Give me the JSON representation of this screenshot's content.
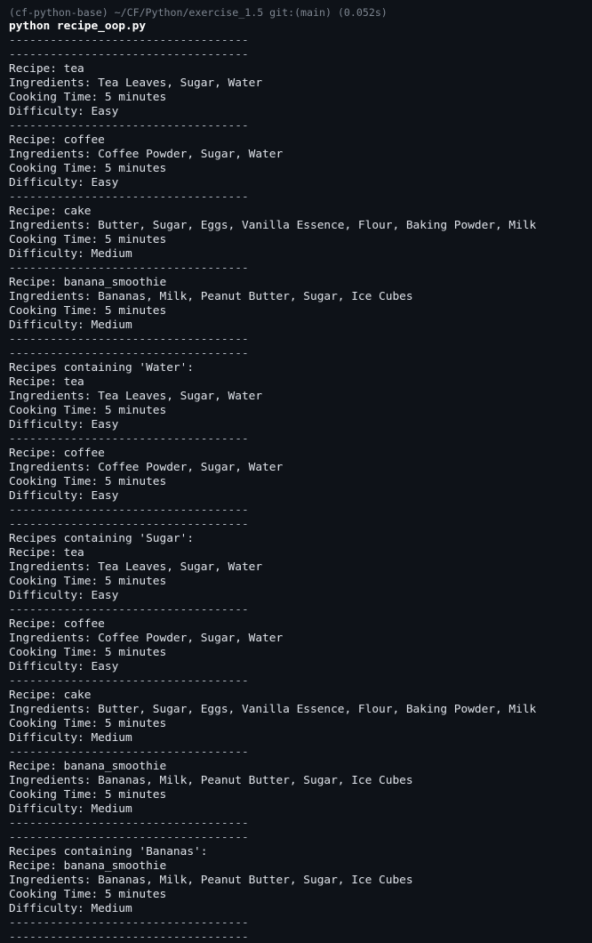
{
  "terminal": {
    "prompt": "(cf-python-base) ~/CF/Python/exercise_1.5 git:(main) (0.052s)",
    "command": "python recipe_oop.py",
    "output_lines": [
      "-----------------------------------",
      "-----------------------------------",
      "Recipe: tea",
      "Ingredients: Tea Leaves, Sugar, Water",
      "Cooking Time: 5 minutes",
      "Difficulty: Easy",
      "-----------------------------------",
      "Recipe: coffee",
      "Ingredients: Coffee Powder, Sugar, Water",
      "Cooking Time: 5 minutes",
      "Difficulty: Easy",
      "-----------------------------------",
      "Recipe: cake",
      "Ingredients: Butter, Sugar, Eggs, Vanilla Essence, Flour, Baking Powder, Milk",
      "Cooking Time: 5 minutes",
      "Difficulty: Medium",
      "-----------------------------------",
      "Recipe: banana_smoothie",
      "Ingredients: Bananas, Milk, Peanut Butter, Sugar, Ice Cubes",
      "Cooking Time: 5 minutes",
      "Difficulty: Medium",
      "-----------------------------------",
      "-----------------------------------",
      "Recipes containing 'Water':",
      "Recipe: tea",
      "Ingredients: Tea Leaves, Sugar, Water",
      "Cooking Time: 5 minutes",
      "Difficulty: Easy",
      "-----------------------------------",
      "Recipe: coffee",
      "Ingredients: Coffee Powder, Sugar, Water",
      "Cooking Time: 5 minutes",
      "Difficulty: Easy",
      "-----------------------------------",
      "-----------------------------------",
      "Recipes containing 'Sugar':",
      "Recipe: tea",
      "Ingredients: Tea Leaves, Sugar, Water",
      "Cooking Time: 5 minutes",
      "Difficulty: Easy",
      "-----------------------------------",
      "Recipe: coffee",
      "Ingredients: Coffee Powder, Sugar, Water",
      "Cooking Time: 5 minutes",
      "Difficulty: Easy",
      "-----------------------------------",
      "Recipe: cake",
      "Ingredients: Butter, Sugar, Eggs, Vanilla Essence, Flour, Baking Powder, Milk",
      "Cooking Time: 5 minutes",
      "Difficulty: Medium",
      "-----------------------------------",
      "Recipe: banana_smoothie",
      "Ingredients: Bananas, Milk, Peanut Butter, Sugar, Ice Cubes",
      "Cooking Time: 5 minutes",
      "Difficulty: Medium",
      "-----------------------------------",
      "-----------------------------------",
      "Recipes containing 'Bananas':",
      "Recipe: banana_smoothie",
      "Ingredients: Bananas, Milk, Peanut Butter, Sugar, Ice Cubes",
      "Cooking Time: 5 minutes",
      "Difficulty: Medium",
      "-----------------------------------",
      "-----------------------------------"
    ]
  },
  "colors": {
    "background": "#0e1218",
    "prompt": "#7d8590",
    "command": "#ffffff",
    "output": "#dfe3ea"
  }
}
